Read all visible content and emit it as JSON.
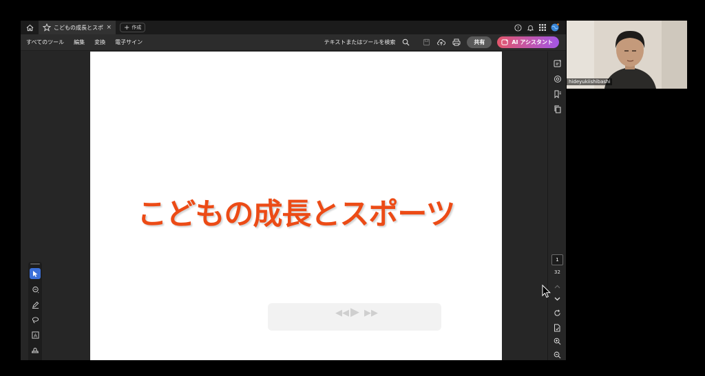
{
  "tab": {
    "title": "こどもの成長とスポ…",
    "close": "×",
    "new_tab_label": "作成",
    "new_tab_plus": "+"
  },
  "menu": {
    "all_tools": "すべてのツール",
    "edit": "編集",
    "convert": "変換",
    "e_sign": "電子サイン"
  },
  "toolbar": {
    "search_label": "テキストまたはツールを検索",
    "share_label": "共有",
    "ai_label": "AI アシスタント"
  },
  "document": {
    "page_title": "こどもの成長とスポーツ"
  },
  "pagination": {
    "current_page": "1",
    "total_pages": "32"
  },
  "webcam": {
    "participant_name": "hideyukiishibashi"
  },
  "colors": {
    "title_color": "#ec4b16",
    "accent_blue": "#3b6fd8",
    "ai_gradient_start": "#e2566b",
    "ai_gradient_end": "#a356e6"
  },
  "icons": {
    "tabbar": [
      "home-icon",
      "star-icon",
      "help-icon",
      "bell-icon",
      "apps-grid-icon",
      "avatar-globe-icon"
    ],
    "toolbar": [
      "search-icon",
      "save-icon",
      "upload-cloud-icon",
      "print-icon",
      "ai-assistant-icon"
    ],
    "palette": [
      "select-arrow-icon",
      "comment-icon",
      "pen-icon",
      "lasso-icon",
      "text-box-icon",
      "stamp-icon",
      "more-icon"
    ],
    "right_rail": [
      "edit-panel-icon",
      "comment-bubble-icon",
      "bookmark-icon",
      "copy-pages-icon",
      "chevron-up-icon",
      "chevron-down-icon",
      "rotate-icon",
      "page-add-icon",
      "zoom-in-icon",
      "zoom-out-icon"
    ]
  }
}
